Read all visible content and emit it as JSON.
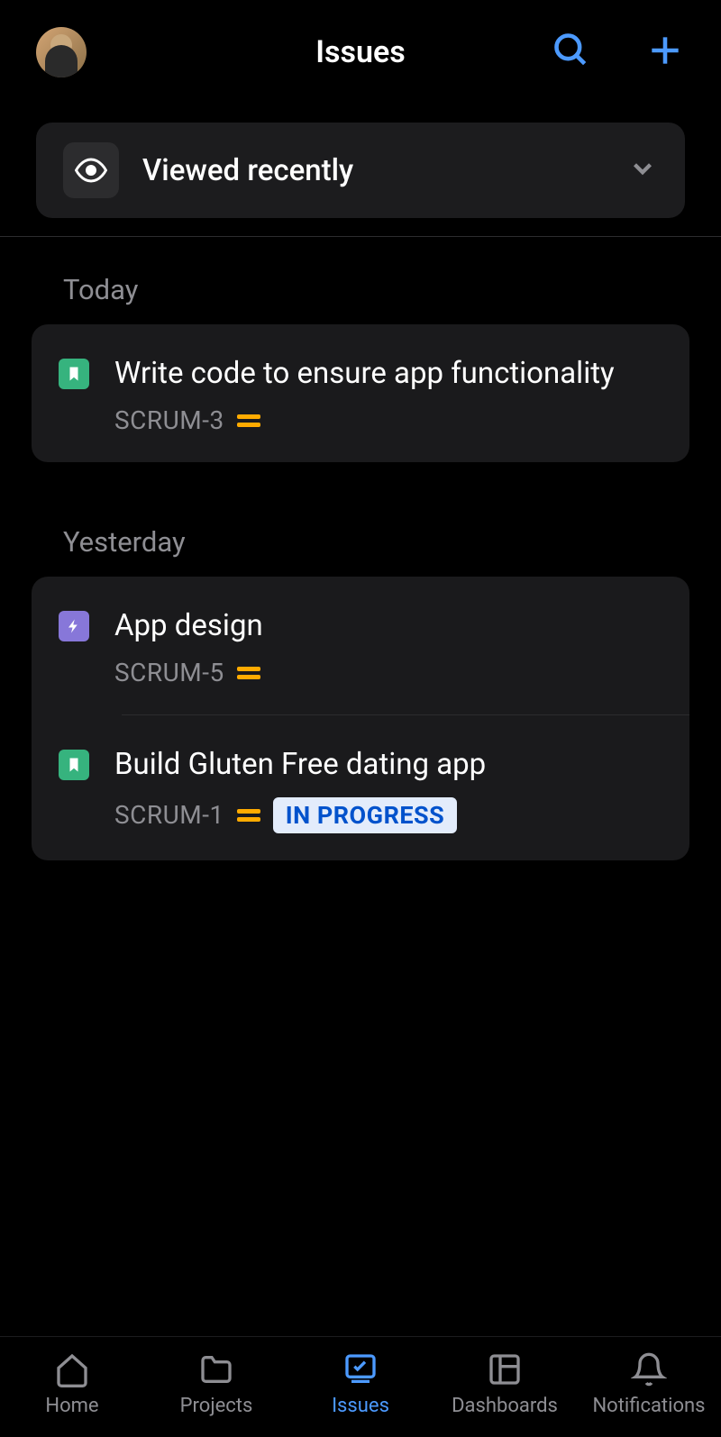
{
  "header": {
    "title": "Issues"
  },
  "filter": {
    "label": "Viewed recently"
  },
  "sections": [
    {
      "label": "Today",
      "issues": [
        {
          "title": "Write code to ensure app functionality",
          "key": "SCRUM-3",
          "type": "story",
          "priority": "medium",
          "status": null
        }
      ]
    },
    {
      "label": "Yesterday",
      "issues": [
        {
          "title": "App design",
          "key": "SCRUM-5",
          "type": "epic",
          "priority": "medium",
          "status": null
        },
        {
          "title": "Build Gluten Free dating app",
          "key": "SCRUM-1",
          "type": "story",
          "priority": "medium",
          "status": "IN PROGRESS"
        }
      ]
    }
  ],
  "nav": {
    "home": "Home",
    "projects": "Projects",
    "issues": "Issues",
    "dashboards": "Dashboards",
    "notifications": "Notifications"
  }
}
